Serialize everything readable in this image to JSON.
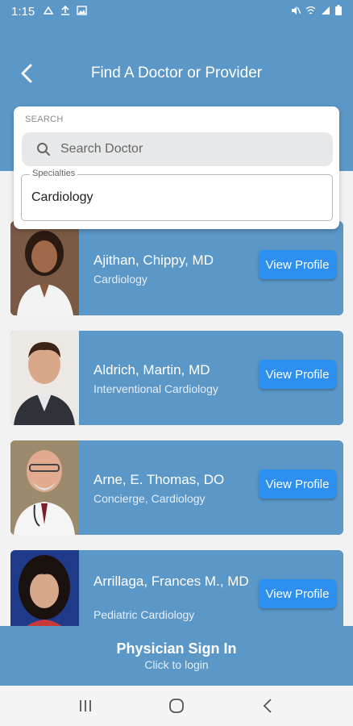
{
  "status_bar": {
    "time": "1:15"
  },
  "header": {
    "title": "Find A Doctor or Provider"
  },
  "search": {
    "section_label": "SEARCH",
    "placeholder": "Search Doctor",
    "specialties_label": "Specialties",
    "specialties_value": "Cardiology"
  },
  "doctors": [
    {
      "name": "Ajithan, Chippy, MD",
      "specialty": "Cardiology",
      "button": "View Profile"
    },
    {
      "name": "Aldrich, Martin, MD",
      "specialty": "Interventional Cardiology",
      "button": "View Profile"
    },
    {
      "name": "Arne, E. Thomas, DO",
      "specialty": "Concierge, Cardiology",
      "button": "View Profile"
    },
    {
      "name": "Arrillaga, Frances M., MD",
      "specialty": "Pediatric Cardiology",
      "button": "View Profile"
    }
  ],
  "signin": {
    "title": "Physician Sign In",
    "subtitle": "Click to login"
  },
  "colors": {
    "primary": "#5b97c7",
    "button": "#2d8ff0"
  }
}
